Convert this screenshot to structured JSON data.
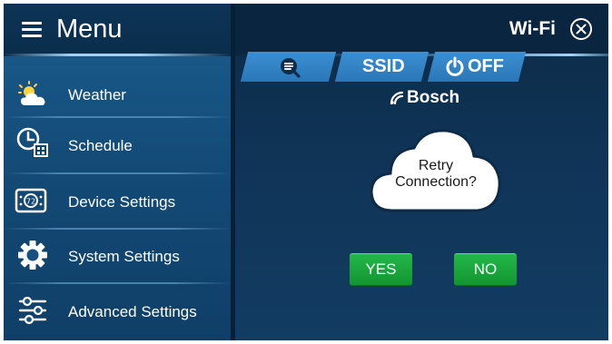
{
  "sidebar": {
    "title": "Menu",
    "items": [
      {
        "label": "Weather",
        "icon": "weather-icon"
      },
      {
        "label": "Schedule",
        "icon": "schedule-icon"
      },
      {
        "label": "Device Settings",
        "icon": "device-settings-icon"
      },
      {
        "label": "System Settings",
        "icon": "gear-icon"
      },
      {
        "label": "Advanced Settings",
        "icon": "sliders-icon"
      }
    ]
  },
  "main": {
    "title": "Wi-Fi",
    "tabs": {
      "search": {
        "icon": "search-icon"
      },
      "ssid": {
        "label": "SSID"
      },
      "power": {
        "label": "OFF",
        "icon": "power-icon"
      }
    },
    "network": {
      "name": "Bosch",
      "icon": "wifi-signal-icon"
    },
    "dialog": {
      "line1": "Retry",
      "line2": "Connection?",
      "yes_label": "YES",
      "no_label": "NO"
    }
  },
  "colors": {
    "accent_blue": "#2f82c6",
    "confirm_green": "#1aa83d",
    "background_navy": "#0b2a45"
  }
}
